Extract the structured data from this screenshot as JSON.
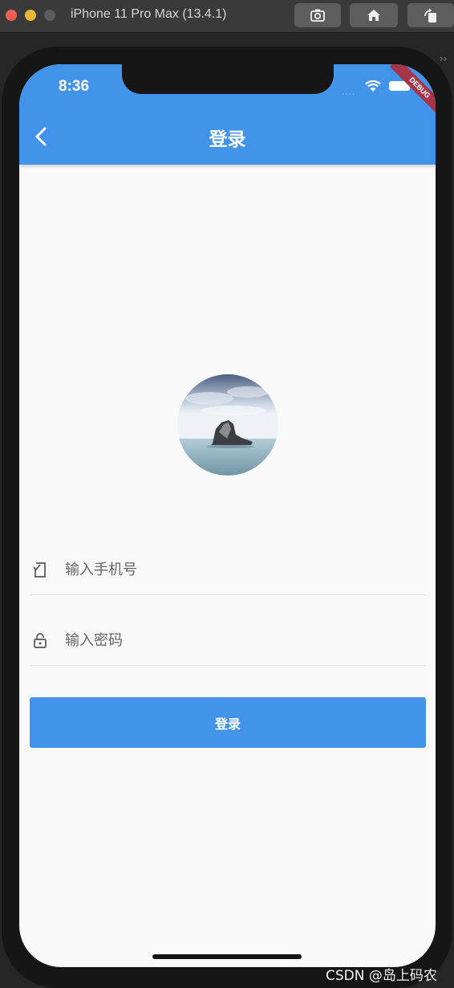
{
  "window": {
    "title": "iPhone 11 Pro Max (13.4.1)",
    "toolbar": [
      "screenshot-icon",
      "home-icon",
      "rotate-icon"
    ],
    "chevrons": "››"
  },
  "status_bar": {
    "time": "8:36",
    "signal": "․․․․",
    "icons": [
      "wifi-icon",
      "battery-icon"
    ],
    "debug_banner": "DEBUG"
  },
  "app_bar": {
    "title": "登录",
    "back_icon": "chevron-left-icon"
  },
  "avatar": {
    "icon": "avatar-rock-island-photo"
  },
  "form": {
    "phone": {
      "placeholder": "输入手机号",
      "value": "",
      "icon": "phone-icon"
    },
    "password": {
      "placeholder": "输入密码",
      "value": "",
      "icon": "lock-icon"
    },
    "submit_label": "登录"
  },
  "colors": {
    "primary": "#4294ea",
    "background": "#f9f9f9",
    "debug_ribbon": "#a53548"
  },
  "watermark": "CSDN @岛上码农"
}
